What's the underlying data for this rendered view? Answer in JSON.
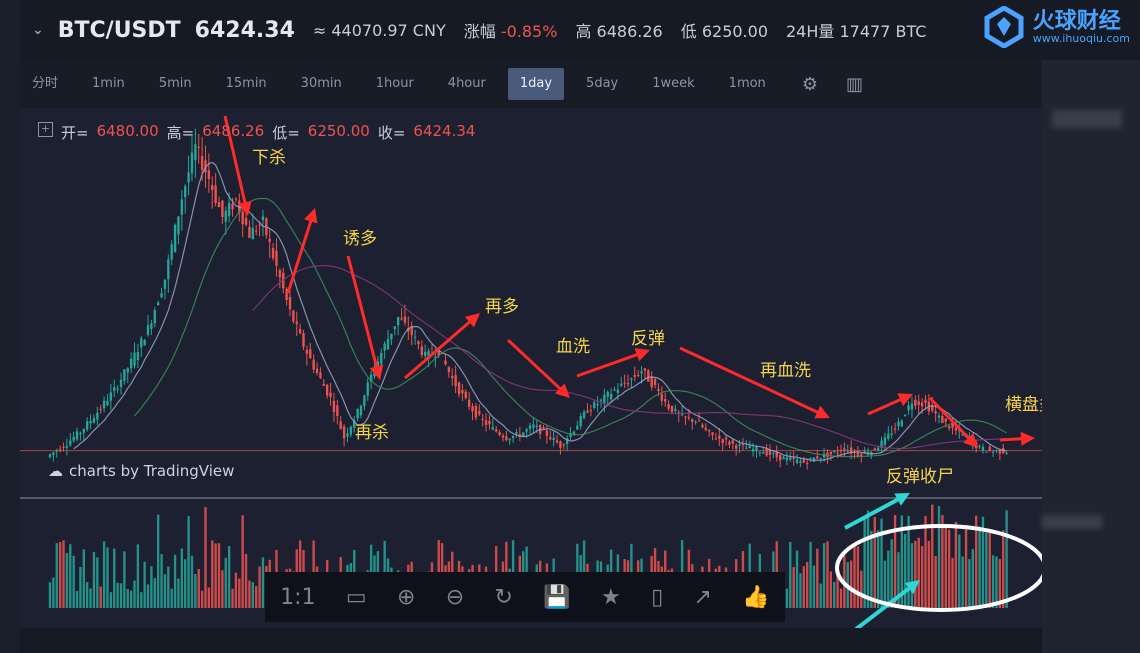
{
  "header": {
    "pair": "BTC/USDT",
    "price": "6424.34",
    "cny": "≈ 44070.97 CNY",
    "change_label": "涨幅",
    "change_value": "-0.85%",
    "high_label": "高",
    "high_value": "6486.26",
    "low_label": "低",
    "low_value": "6250.00",
    "vol24_label": "24H量",
    "vol24_value": "17477 BTC"
  },
  "brand": {
    "name": "火球财经",
    "url": "www.ihuoqiu.com",
    "color": "#4aa3ff"
  },
  "toolbar": {
    "intervals": [
      "分时",
      "1min",
      "5min",
      "15min",
      "30min",
      "1hour",
      "4hour",
      "1day",
      "5day",
      "1week",
      "1mon"
    ],
    "active": "1day"
  },
  "ohlc": {
    "open_label": "开=",
    "open": "6480.00",
    "high_label": "高=",
    "high": "6486.26",
    "low_label": "低=",
    "low": "6250.00",
    "close_label": "收=",
    "close": "6424.34"
  },
  "watermark": "charts by TradingView",
  "bottom_tools": [
    "1:1",
    "▭",
    "⊕",
    "⊖",
    "↻",
    "💾",
    "★",
    "▯",
    "↗",
    "👍"
  ],
  "colors": {
    "up": "#26a69a",
    "down": "#ef5350",
    "annotation_text": "#f6d44a",
    "arrow_red": "#ff2b2b",
    "arrow_cyan": "#2fd6d6"
  },
  "chart_data": {
    "type": "candlestick",
    "annotations": [
      "下杀",
      "诱多",
      "再多",
      "血洗",
      "反弹",
      "再血洗",
      "再杀",
      "横盘炙烤",
      "反弹收尸"
    ],
    "price_path": [
      [
        0,
        6200
      ],
      [
        5,
        6600
      ],
      [
        10,
        7100
      ],
      [
        15,
        7800
      ],
      [
        20,
        8600
      ],
      [
        25,
        9600
      ],
      [
        30,
        10800
      ],
      [
        35,
        12600
      ],
      [
        40,
        15500
      ],
      [
        44,
        17300
      ],
      [
        48,
        16200
      ],
      [
        52,
        14800
      ],
      [
        56,
        15400
      ],
      [
        60,
        14200
      ],
      [
        64,
        14600
      ],
      [
        68,
        13000
      ],
      [
        72,
        11400
      ],
      [
        76,
        10200
      ],
      [
        80,
        9200
      ],
      [
        84,
        8300
      ],
      [
        88,
        6900
      ],
      [
        92,
        7800
      ],
      [
        96,
        9100
      ],
      [
        100,
        10200
      ],
      [
        104,
        11200
      ],
      [
        108,
        10600
      ],
      [
        112,
        9800
      ],
      [
        116,
        10000
      ],
      [
        120,
        9000
      ],
      [
        124,
        8200
      ],
      [
        128,
        7600
      ],
      [
        132,
        7200
      ],
      [
        136,
        6900
      ],
      [
        140,
        7000
      ],
      [
        144,
        7300
      ],
      [
        148,
        7000
      ],
      [
        152,
        6600
      ],
      [
        156,
        7200
      ],
      [
        160,
        7900
      ],
      [
        164,
        8200
      ],
      [
        168,
        8600
      ],
      [
        172,
        8900
      ],
      [
        176,
        9300
      ],
      [
        180,
        8700
      ],
      [
        184,
        8000
      ],
      [
        188,
        7600
      ],
      [
        192,
        7500
      ],
      [
        196,
        7000
      ],
      [
        200,
        6800
      ],
      [
        204,
        6600
      ],
      [
        208,
        6500
      ],
      [
        212,
        6400
      ],
      [
        216,
        6200
      ],
      [
        220,
        6100
      ],
      [
        224,
        6000
      ],
      [
        228,
        6200
      ],
      [
        232,
        6300
      ],
      [
        236,
        6500
      ],
      [
        240,
        6300
      ],
      [
        244,
        6400
      ],
      [
        248,
        6800
      ],
      [
        252,
        7400
      ],
      [
        256,
        8200
      ],
      [
        260,
        8100
      ],
      [
        264,
        7600
      ],
      [
        268,
        7200
      ],
      [
        272,
        6900
      ],
      [
        276,
        6500
      ],
      [
        280,
        6400
      ],
      [
        284,
        6420
      ]
    ],
    "volume_highlight": "last 30 sessions",
    "ylim": [
      5800,
      18000
    ]
  }
}
